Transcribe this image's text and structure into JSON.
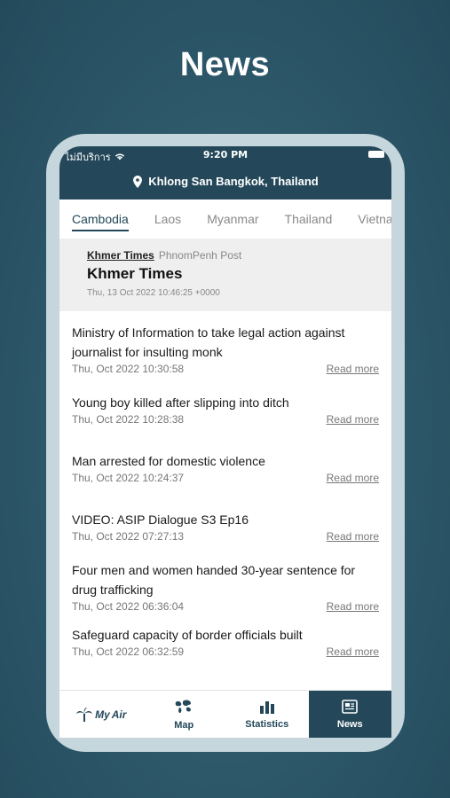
{
  "hero": {
    "title": "News"
  },
  "status_bar": {
    "carrier": "ไม่มีบริการ",
    "time": "9:20 PM"
  },
  "location": {
    "text": "Khlong San Bangkok, Thailand"
  },
  "tabs": [
    {
      "label": "Cambodia",
      "active": true
    },
    {
      "label": "Laos",
      "active": false
    },
    {
      "label": "Myanmar",
      "active": false
    },
    {
      "label": "Thailand",
      "active": false
    },
    {
      "label": "Vietnam",
      "active": false
    }
  ],
  "source": {
    "links": [
      "Khmer Times",
      "PhnomPenh Post"
    ],
    "title": "Khmer Times",
    "date": "Thu, 13 Oct 2022 10:46:25 +0000"
  },
  "news": [
    {
      "title": "Ministry of Information to take legal action against journalist for insulting monk",
      "date": "Thu, Oct 2022 10:30:58",
      "read_more": "Read more"
    },
    {
      "title": "Young boy killed after slipping into ditch",
      "date": "Thu, Oct 2022 10:28:38",
      "read_more": "Read more"
    },
    {
      "title": "Man arrested for domestic violence",
      "date": "Thu, Oct 2022 10:24:37",
      "read_more": "Read more"
    },
    {
      "title": "VIDEO: ASIP Dialogue S3 Ep16",
      "date": "Thu, Oct 2022 07:27:13",
      "read_more": "Read more"
    },
    {
      "title": "Four men and women handed 30-year sentence for drug trafficking",
      "date": "Thu, Oct 2022 06:36:04",
      "read_more": "Read more"
    },
    {
      "title": "Safeguard capacity of border officials built",
      "date": "Thu, Oct 2022 06:32:59",
      "read_more": "Read more"
    }
  ],
  "nav": {
    "logo_my": "My",
    "logo_air": "Air",
    "map": "Map",
    "statistics": "Statistics",
    "news": "News"
  },
  "colors": {
    "primary": "#24485a",
    "background": "#2f5b6d"
  }
}
